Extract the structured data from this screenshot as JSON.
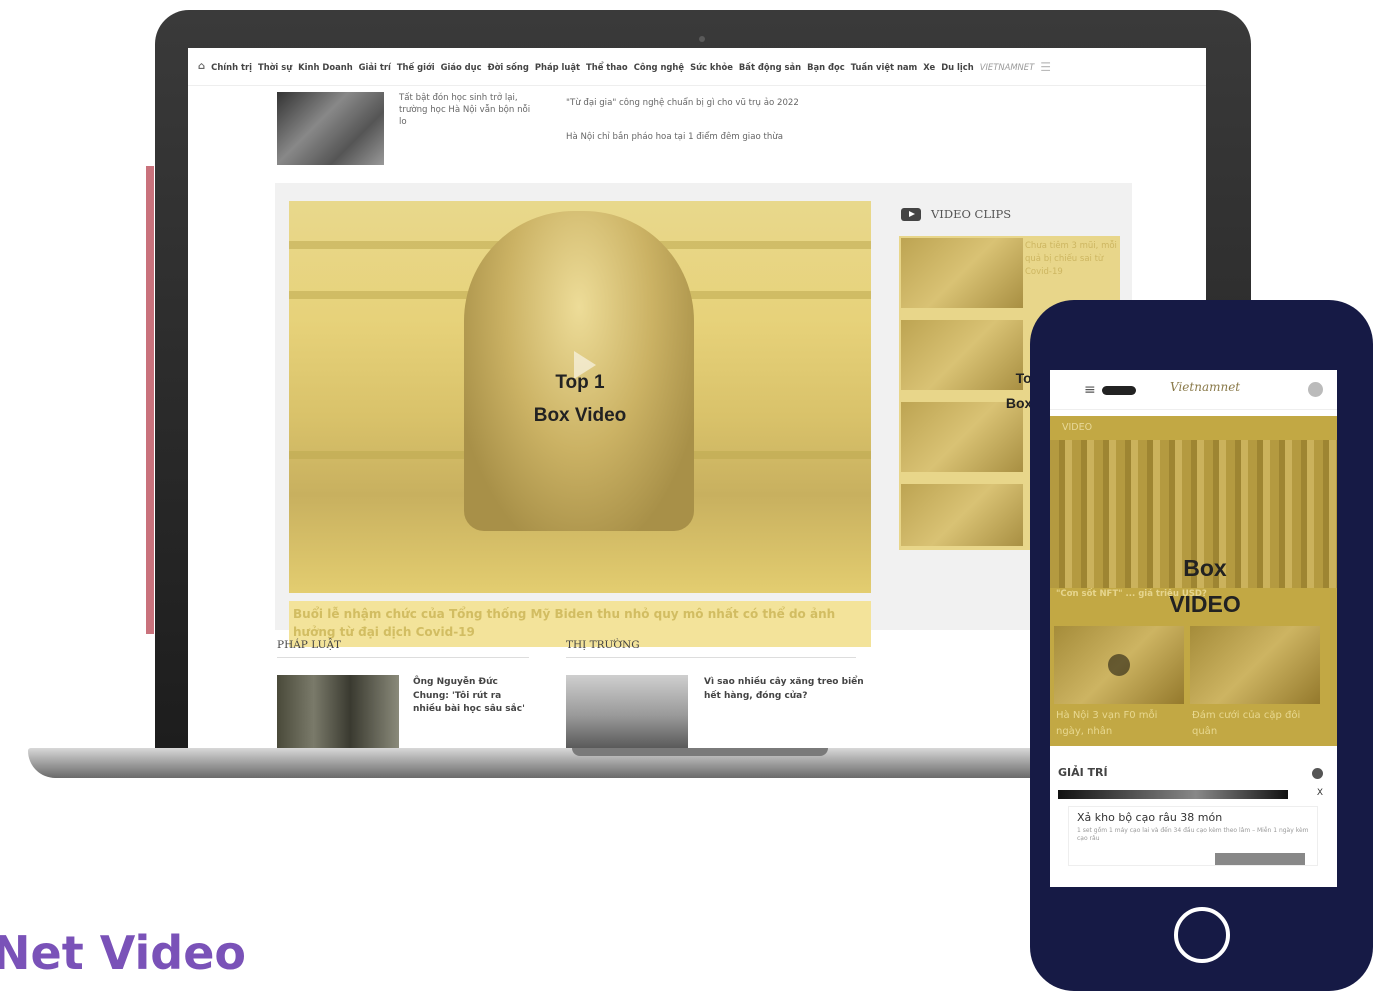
{
  "navigation": {
    "items": [
      "Chính trị",
      "Thời sự",
      "Kinh Doanh",
      "Giải trí",
      "Thế giới",
      "Giáo dục",
      "Đời sống",
      "Pháp luật",
      "Thể thao",
      "Công nghệ",
      "Sức khỏe",
      "Bất động sản",
      "Bạn đọc",
      "Tuần việt nam",
      "Xe",
      "Du lịch"
    ],
    "logo_text": "VIETNAMNET"
  },
  "top_news": {
    "story": "Tất bật đón học sinh trở lại, trường học Hà Nội vẫn bộn nỗi lo",
    "headline_1": "\"Từ đại gia\" công nghệ chuẩn bị gì cho vũ trụ ảo 2022",
    "headline_2": "Hà Nội chỉ bắn pháo hoa tại 1 điểm đêm giao thừa"
  },
  "video_section": {
    "main_overlay_line1": "Top 1",
    "main_overlay_line2": "Box Video",
    "main_caption": "Buổi lễ nhậm chức của Tổng thống Mỹ Biden thu nhỏ quy mô nhất có thể do ảnh hưởng từ đại dịch Covid-19",
    "clips_title": "VIDEO CLIPS",
    "clip_1_text": "Chưa tiêm 3 mũi, mỗi quả bị chiếu sai từ Covid-19",
    "clips_overlay_line1": "Top 2-4",
    "clips_overlay_line2": "Box Video"
  },
  "sections": {
    "phap_luat": {
      "title": "PHÁP LUẬT",
      "article": "Ông Nguyễn Đức Chung: 'Tôi rút ra nhiều bài học sâu sắc'"
    },
    "thi_truong": {
      "title": "THỊ TRƯỜNG",
      "article": "Vì sao nhiều cây xăng treo biển hết hàng, đóng cửa?"
    }
  },
  "page_title": "Net Video",
  "phone": {
    "logo": "Vietnamnet",
    "video_label": "VIDEO",
    "overlay_line1": "Box",
    "overlay_line2": "VIDEO",
    "headline": "\"Cơn sốt NFT\" ... giá triệu USD?",
    "caption_1": "Hà Nội 3 vạn F0 mỗi ngày, nhân",
    "caption_2": "Đám cưới của cặp đôi quân",
    "section_title": "GIẢI TRÍ",
    "ad_close": "X",
    "ad_title": "Xả kho bộ cạo râu 38 món",
    "ad_desc": "1 set gồm 1 máy cạo lai và đến 34 đầu cạo kèm theo lâm – Miễn 1 ngày kèm cạo râu"
  }
}
